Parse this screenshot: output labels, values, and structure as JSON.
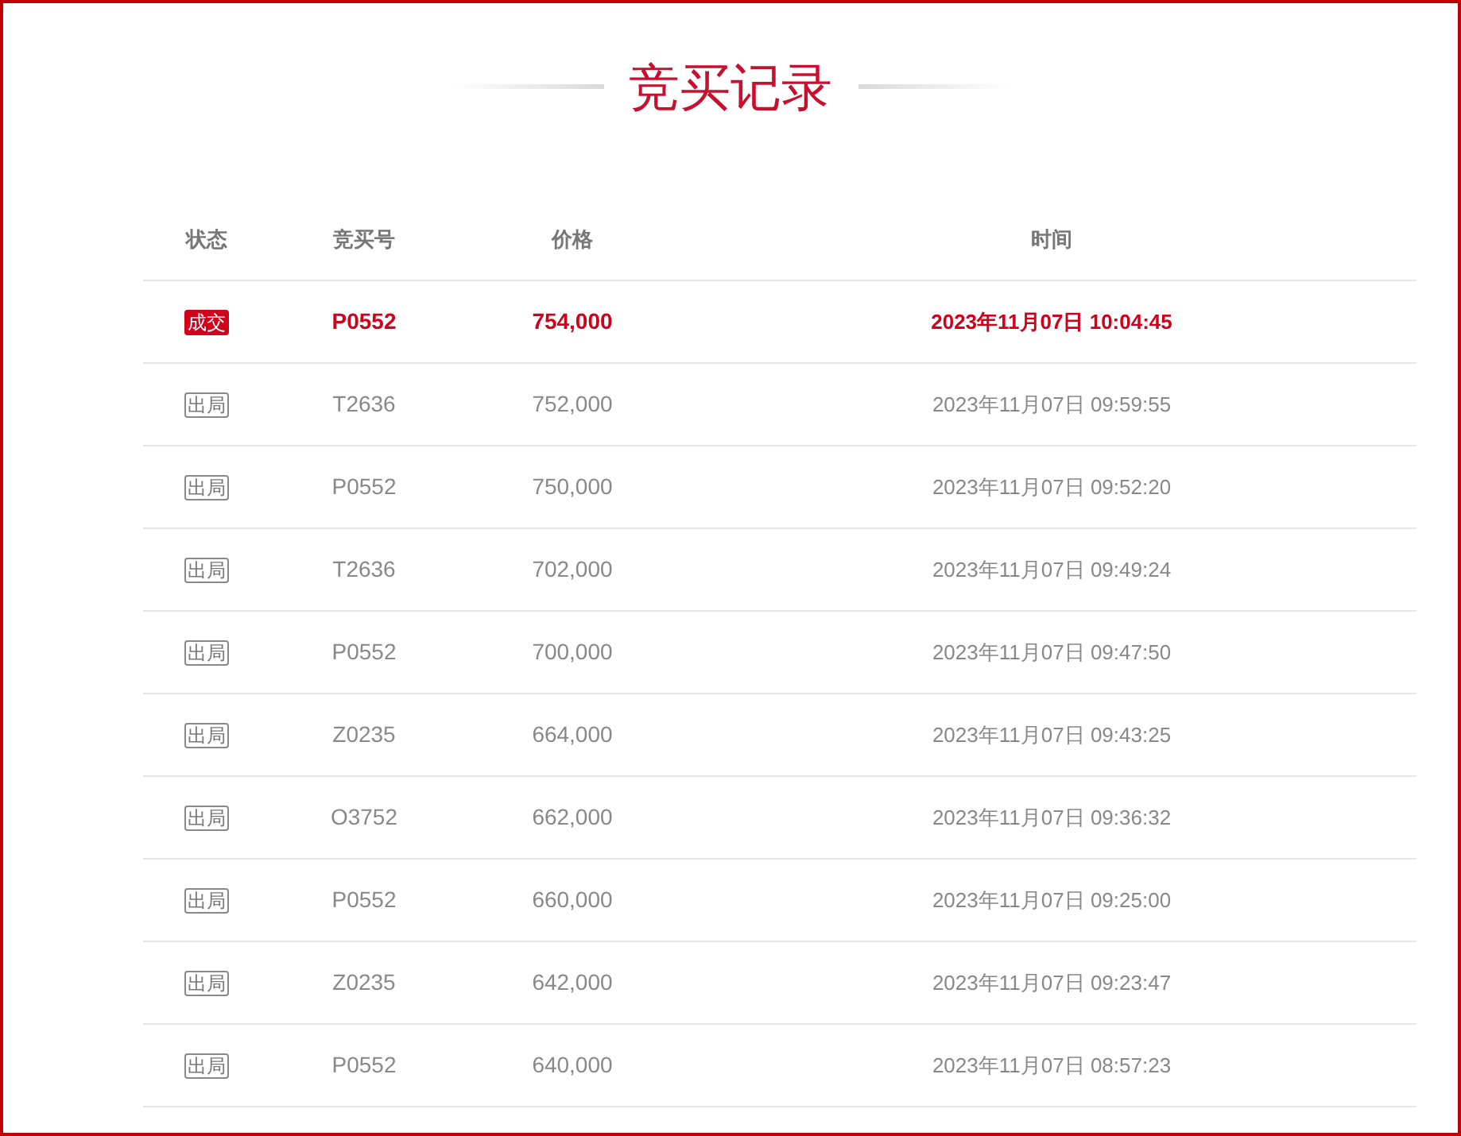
{
  "title": "竞买记录",
  "table": {
    "columns": [
      "状态",
      "竞买号",
      "价格",
      "时间"
    ],
    "rows": [
      {
        "kind": "won",
        "status": "成交",
        "bidder": "P0552",
        "price": "754,000",
        "time": "2023年11月07日 10:04:45"
      },
      {
        "kind": "outbid",
        "status": "出局",
        "bidder": "T2636",
        "price": "752,000",
        "time": "2023年11月07日 09:59:55"
      },
      {
        "kind": "outbid",
        "status": "出局",
        "bidder": "P0552",
        "price": "750,000",
        "time": "2023年11月07日 09:52:20"
      },
      {
        "kind": "outbid",
        "status": "出局",
        "bidder": "T2636",
        "price": "702,000",
        "time": "2023年11月07日 09:49:24"
      },
      {
        "kind": "outbid",
        "status": "出局",
        "bidder": "P0552",
        "price": "700,000",
        "time": "2023年11月07日 09:47:50"
      },
      {
        "kind": "outbid",
        "status": "出局",
        "bidder": "Z0235",
        "price": "664,000",
        "time": "2023年11月07日 09:43:25"
      },
      {
        "kind": "outbid",
        "status": "出局",
        "bidder": "O3752",
        "price": "662,000",
        "time": "2023年11月07日 09:36:32"
      },
      {
        "kind": "outbid",
        "status": "出局",
        "bidder": "P0552",
        "price": "660,000",
        "time": "2023年11月07日 09:25:00"
      },
      {
        "kind": "outbid",
        "status": "出局",
        "bidder": "Z0235",
        "price": "642,000",
        "time": "2023年11月07日 09:23:47"
      },
      {
        "kind": "outbid",
        "status": "出局",
        "bidder": "P0552",
        "price": "640,000",
        "time": "2023年11月07日 08:57:23"
      }
    ]
  }
}
